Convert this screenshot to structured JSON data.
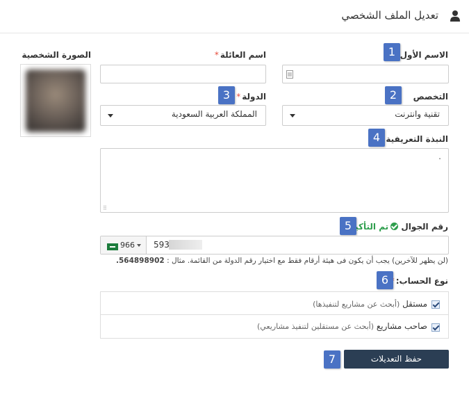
{
  "header": {
    "title": "تعديل الملف الشخصي"
  },
  "photo": {
    "label": "الصورة الشخصية"
  },
  "fields": {
    "first_name": {
      "label": "الاسم الأول",
      "required": "*",
      "value": ""
    },
    "last_name": {
      "label": "اسم العائلة",
      "required": "*",
      "value": ""
    },
    "specialty": {
      "label": "التخصص",
      "selected": "تقنية وانترنت"
    },
    "country": {
      "label": "الدولة",
      "required": "*",
      "selected": "المملكة العربية السعودية"
    },
    "bio": {
      "label": "النبذة التعريفية",
      "required": "*",
      "value": "."
    },
    "mobile": {
      "label": "رقم الجوال",
      "verified": "تم التأكيد",
      "required": "*",
      "country_code": "966",
      "value": "593",
      "hint": "(لن يظهر للآخرين) يجب أن يكون فى هيئة أرقام فقط مع اختيار رقم الدولة من القائمة. مثال :",
      "example": "564898902."
    },
    "account_type": {
      "label": "نوع الحساب:",
      "required": "*",
      "options": [
        {
          "title": "مستقل",
          "desc": "(أبحث عن مشاريع لتنفيذها)",
          "checked": true
        },
        {
          "title": "صاحب مشاريع",
          "desc": "(أبحث عن مستقلين لتنفيذ مشاريعي)",
          "checked": true
        }
      ]
    }
  },
  "save_button": {
    "label": "حفظ التعديلات"
  },
  "badges": [
    "1",
    "2",
    "3",
    "4",
    "5",
    "6",
    "7"
  ],
  "colors": {
    "badge": "#4a72c4",
    "required": "#e74c3c",
    "verified": "#2e9e4d",
    "save_button": "#2b3e54"
  }
}
